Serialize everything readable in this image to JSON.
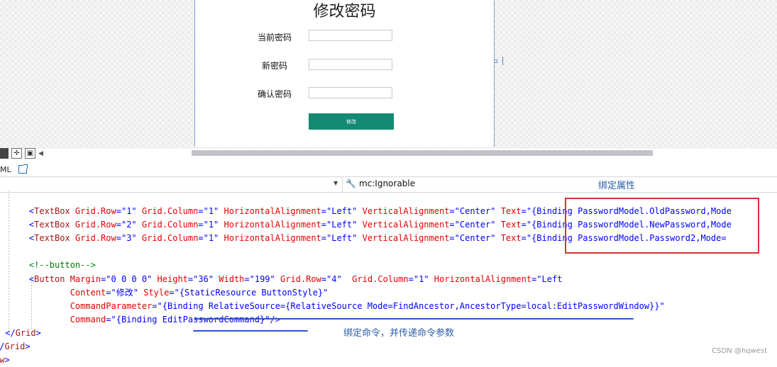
{
  "designer": {
    "window_title": "修改密码",
    "fields": [
      {
        "label": "当前密码",
        "value": ""
      },
      {
        "label": "新密码",
        "value": ""
      },
      {
        "label": "确认密码",
        "value": ""
      }
    ],
    "submit_label": "修改"
  },
  "tab_bar": {
    "tab_label": "ML"
  },
  "nav_bar": {
    "right_member": "mc:Ignorable"
  },
  "annotations": {
    "bind_property": "绑定属性",
    "bind_command": "绑定命令，并传递命令参数"
  },
  "code_lines": [
    {
      "segments": [
        [
          "punc",
          "    <"
        ],
        [
          "tag",
          "TextBox"
        ],
        [
          "attr",
          " Grid.Row"
        ],
        [
          "punc",
          "=\""
        ],
        [
          "val",
          "1"
        ],
        [
          "punc",
          "\""
        ],
        [
          "attr",
          " Grid.Column"
        ],
        [
          "punc",
          "=\""
        ],
        [
          "val",
          "1"
        ],
        [
          "punc",
          "\""
        ],
        [
          "attr",
          " HorizontalAlignment"
        ],
        [
          "punc",
          "=\""
        ],
        [
          "val",
          "Left"
        ],
        [
          "punc",
          "\""
        ],
        [
          "attr",
          " VerticalAlignment"
        ],
        [
          "punc",
          "=\""
        ],
        [
          "val",
          "Center"
        ],
        [
          "punc",
          "\""
        ],
        [
          "attr",
          " Text"
        ],
        [
          "punc",
          "=\""
        ],
        [
          "val",
          "{Binding PasswordModel.OldPassword,Mode"
        ]
      ]
    },
    {
      "segments": [
        [
          "punc",
          "    <"
        ],
        [
          "tag",
          "TextBox"
        ],
        [
          "attr",
          " Grid.Row"
        ],
        [
          "punc",
          "=\""
        ],
        [
          "val",
          "2"
        ],
        [
          "punc",
          "\""
        ],
        [
          "attr",
          " Grid.Column"
        ],
        [
          "punc",
          "=\""
        ],
        [
          "val",
          "1"
        ],
        [
          "punc",
          "\""
        ],
        [
          "attr",
          " HorizontalAlignment"
        ],
        [
          "punc",
          "=\""
        ],
        [
          "val",
          "Left"
        ],
        [
          "punc",
          "\""
        ],
        [
          "attr",
          " VerticalAlignment"
        ],
        [
          "punc",
          "=\""
        ],
        [
          "val",
          "Center"
        ],
        [
          "punc",
          "\""
        ],
        [
          "attr",
          " Text"
        ],
        [
          "punc",
          "=\""
        ],
        [
          "val",
          "{Binding PasswordModel.NewPassword,Mode"
        ]
      ]
    },
    {
      "segments": [
        [
          "punc",
          "    <"
        ],
        [
          "tag",
          "TextBox"
        ],
        [
          "attr",
          " Grid.Row"
        ],
        [
          "punc",
          "=\""
        ],
        [
          "val",
          "3"
        ],
        [
          "punc",
          "\""
        ],
        [
          "attr",
          " Grid.Column"
        ],
        [
          "punc",
          "=\""
        ],
        [
          "val",
          "1"
        ],
        [
          "punc",
          "\""
        ],
        [
          "attr",
          " HorizontalAlignment"
        ],
        [
          "punc",
          "=\""
        ],
        [
          "val",
          "Left"
        ],
        [
          "punc",
          "\""
        ],
        [
          "attr",
          " VerticalAlignment"
        ],
        [
          "punc",
          "=\""
        ],
        [
          "val",
          "Center"
        ],
        [
          "punc",
          "\""
        ],
        [
          "attr",
          " Text"
        ],
        [
          "punc",
          "=\""
        ],
        [
          "val",
          "{Binding PasswordModel.Password2,Mode="
        ]
      ]
    },
    {
      "segments": [
        [
          "punc",
          ""
        ]
      ]
    },
    {
      "segments": [
        [
          "cmt",
          "    <!--button-->"
        ]
      ]
    },
    {
      "segments": [
        [
          "punc",
          "    <"
        ],
        [
          "tag",
          "Button"
        ],
        [
          "attr",
          " Margin"
        ],
        [
          "punc",
          "=\""
        ],
        [
          "val",
          "0 0 0 0"
        ],
        [
          "punc",
          "\""
        ],
        [
          "attr",
          " Height"
        ],
        [
          "punc",
          "=\""
        ],
        [
          "val",
          "36"
        ],
        [
          "punc",
          "\""
        ],
        [
          "attr",
          " Width"
        ],
        [
          "punc",
          "=\""
        ],
        [
          "val",
          "199"
        ],
        [
          "punc",
          "\""
        ],
        [
          "attr",
          " Grid.Row"
        ],
        [
          "punc",
          "=\""
        ],
        [
          "val",
          "4"
        ],
        [
          "punc",
          "\" "
        ],
        [
          "attr",
          " Grid.Column"
        ],
        [
          "punc",
          "=\""
        ],
        [
          "val",
          "1"
        ],
        [
          "punc",
          "\""
        ],
        [
          "attr",
          " HorizontalAlignment"
        ],
        [
          "punc",
          "=\""
        ],
        [
          "val",
          "Left"
        ]
      ]
    },
    {
      "segments": [
        [
          "attr",
          "            Content"
        ],
        [
          "punc",
          "=\""
        ],
        [
          "val",
          "修改"
        ],
        [
          "punc",
          "\""
        ],
        [
          "attr",
          " Style"
        ],
        [
          "punc",
          "=\""
        ],
        [
          "val",
          "{StaticResource ButtonStyle}"
        ],
        [
          "punc",
          "\""
        ]
      ]
    },
    {
      "segments": [
        [
          "attr",
          "            CommandParameter"
        ],
        [
          "punc",
          "=\""
        ],
        [
          "val",
          "{Binding RelativeSource={RelativeSource Mode=FindAncestor,AncestorType=local:EditPasswordWindow}}"
        ],
        [
          "punc",
          "\""
        ]
      ]
    },
    {
      "segments": [
        [
          "attr",
          "            Command"
        ],
        [
          "punc",
          "=\""
        ],
        [
          "val",
          "{Binding EditPasswordCommand}"
        ],
        [
          "punc",
          "\"/>"
        ]
      ]
    },
    {
      "segments": [
        [
          "punc",
          " </"
        ],
        [
          "tag",
          "Grid"
        ],
        [
          "punc",
          ">"
        ]
      ]
    },
    {
      "segments": [
        [
          "punc",
          "</"
        ],
        [
          "tag",
          "Grid"
        ],
        [
          "punc",
          ">"
        ]
      ]
    },
    {
      "segments": [
        [
          "tag",
          "ow"
        ],
        [
          "punc",
          ">"
        ]
      ]
    }
  ],
  "watermark": "CSDN @hqwest"
}
